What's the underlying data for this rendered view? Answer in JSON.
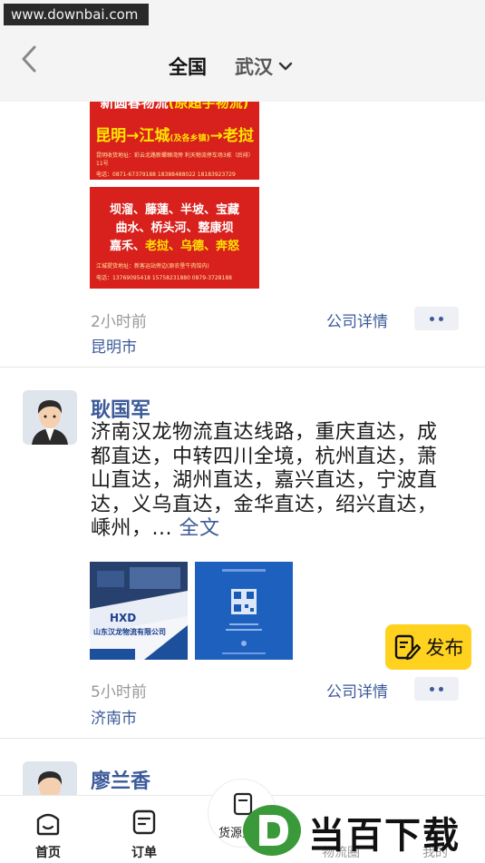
{
  "watermark": {
    "text": "www.downbai.com"
  },
  "header": {
    "back_icon": "chevron-left-icon",
    "tab_national": "全国",
    "city": "武汉",
    "city_dropdown_icon": "chevron-down-icon"
  },
  "post1": {
    "poster_top": {
      "title_line": "新圆春物流",
      "title_paren": "(原超宇物流)",
      "route_left": "昆明→江城",
      "route_paren": "(及各乡镇)",
      "route_right": "→老挝",
      "addr": "昆明收货地址：彩云北路新螺蛳湾旁 利天物流停车场3栋（后排）11号",
      "phone": "电话：0871-67379188 18388488022 18183923729"
    },
    "poster_bottom": {
      "line1": "坝溜、藤蓮、半坡、宝藏",
      "line2": "曲水、桥头河、整康坝",
      "line3a": "嘉禾、",
      "line3b": "老挝、乌德、奔怒",
      "addr": "江城提货地址：新客运站旁边(原农垦牛肉馆内)",
      "phone": "电话：13769095418 15758231880 0879-3728188"
    },
    "time": "2小时前",
    "company_link": "公司详情",
    "city": "昆明市"
  },
  "post2": {
    "name": "耿国军",
    "text": "济南汉龙物流直达线路，重庆直达，成都直达，中转四川全境，杭州直达，萧山直达，湖州直达，嘉兴直达，宁波直达，义乌直达，金华直达，绍兴直达，嵊州，",
    "ellipsis": "...",
    "full_text": "全文",
    "image1_company": "山东汉龙物流有限公司",
    "image1_logo": "HXD",
    "time": "5小时前",
    "company_link": "公司详情",
    "city": "济南市"
  },
  "post3": {
    "name": "廖兰香"
  },
  "publish": {
    "label": "发布"
  },
  "tabbar": {
    "home": "首页",
    "orders": "订单",
    "cargo": "货源大厅",
    "logistics": "物流圈",
    "mine": "我的"
  },
  "brand": {
    "text": "当百下载"
  },
  "colors": {
    "accent_blue": "#3c5a99",
    "publish_yellow": "#ffd21f",
    "poster_red": "#d8201c",
    "poster_yellow": "#ffe600",
    "brand_green": "#3a9a3a"
  }
}
